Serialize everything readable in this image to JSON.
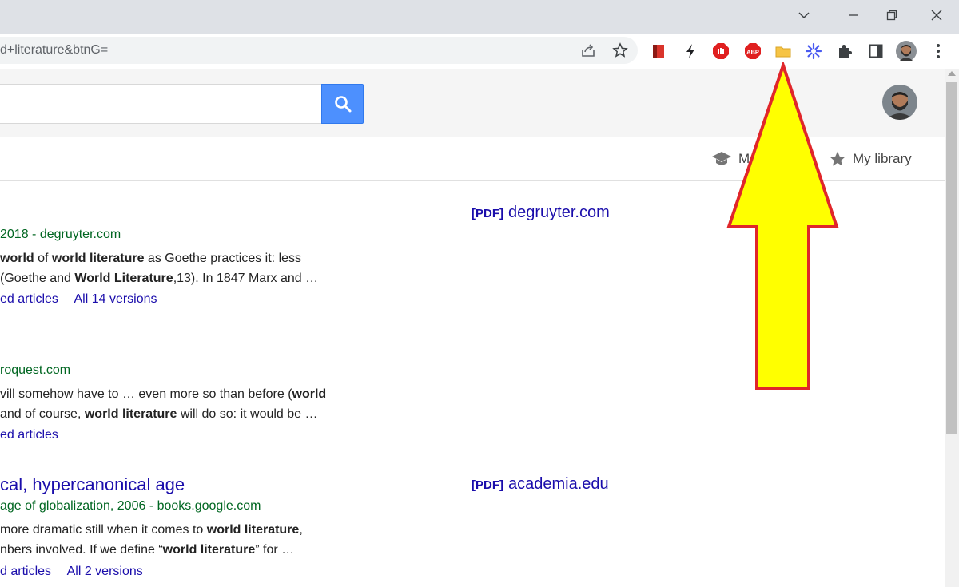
{
  "browser": {
    "url": "d+literature&btnG="
  },
  "scholar": {
    "nav_metrics_partial": "M",
    "nav_library": "My library"
  },
  "results": [
    {
      "meta": "2018 - degruyter.com",
      "snippet": [
        {
          "t": "world",
          "b": true
        },
        {
          "t": " of ",
          "b": false
        },
        {
          "t": "world literature",
          "b": true
        },
        {
          "t": " as Goethe practices it: less",
          "b": false
        }
      ],
      "snippet2": [
        {
          "t": "(Goethe and ",
          "b": false
        },
        {
          "t": "World Literature",
          "b": true
        },
        {
          "t": ",13). In 1847 Marx and …",
          "b": false
        }
      ],
      "links": [
        "ed articles",
        "All 14 versions"
      ],
      "side_tag": "[PDF]",
      "side_domain": "degruyter.com"
    },
    {
      "meta": "roquest.com",
      "snippet": [
        {
          "t": "vill somehow have to … even more so than before (",
          "b": false
        },
        {
          "t": "world",
          "b": true
        }
      ],
      "snippet2": [
        {
          "t": "and of course, ",
          "b": false
        },
        {
          "t": "world literature",
          "b": true
        },
        {
          "t": " will do so: it would be …",
          "b": false
        }
      ],
      "links": [
        "ed articles"
      ]
    },
    {
      "title": "cal, hypercanonical age",
      "meta_prefix": " age of globalization, 2006 - ",
      "meta_domain": "books.google.com",
      "snippet": [
        {
          "t": "more dramatic still when it comes to ",
          "b": false
        },
        {
          "t": "world literature",
          "b": true
        },
        {
          "t": ",",
          "b": false
        }
      ],
      "snippet2": [
        {
          "t": "nbers involved. If we define “",
          "b": false
        },
        {
          "t": "world literature",
          "b": true
        },
        {
          "t": "” for …",
          "b": false
        }
      ],
      "links": [
        "d articles",
        "All 2 versions"
      ],
      "side_tag": "[PDF]",
      "side_domain": "academia.edu"
    }
  ],
  "colors": {
    "link": "#1a0dab",
    "green": "#006621",
    "search_blue": "#4d90fe",
    "arrow_fill": "#ffff00",
    "arrow_stroke": "#e0262a"
  },
  "icons": [
    "chevron-down-icon",
    "minimize-icon",
    "restore-icon",
    "close-icon",
    "share-icon",
    "star-icon",
    "bookmark-ext-icon",
    "bolt-ext-icon",
    "stop-ext-icon",
    "abp-ext-icon",
    "folder-ext-icon",
    "spark-ext-icon",
    "puzzle-icon",
    "sidepanel-icon",
    "profile-avatar",
    "menu-dots-icon",
    "search-icon",
    "mortarboard-icon",
    "library-star-icon"
  ]
}
